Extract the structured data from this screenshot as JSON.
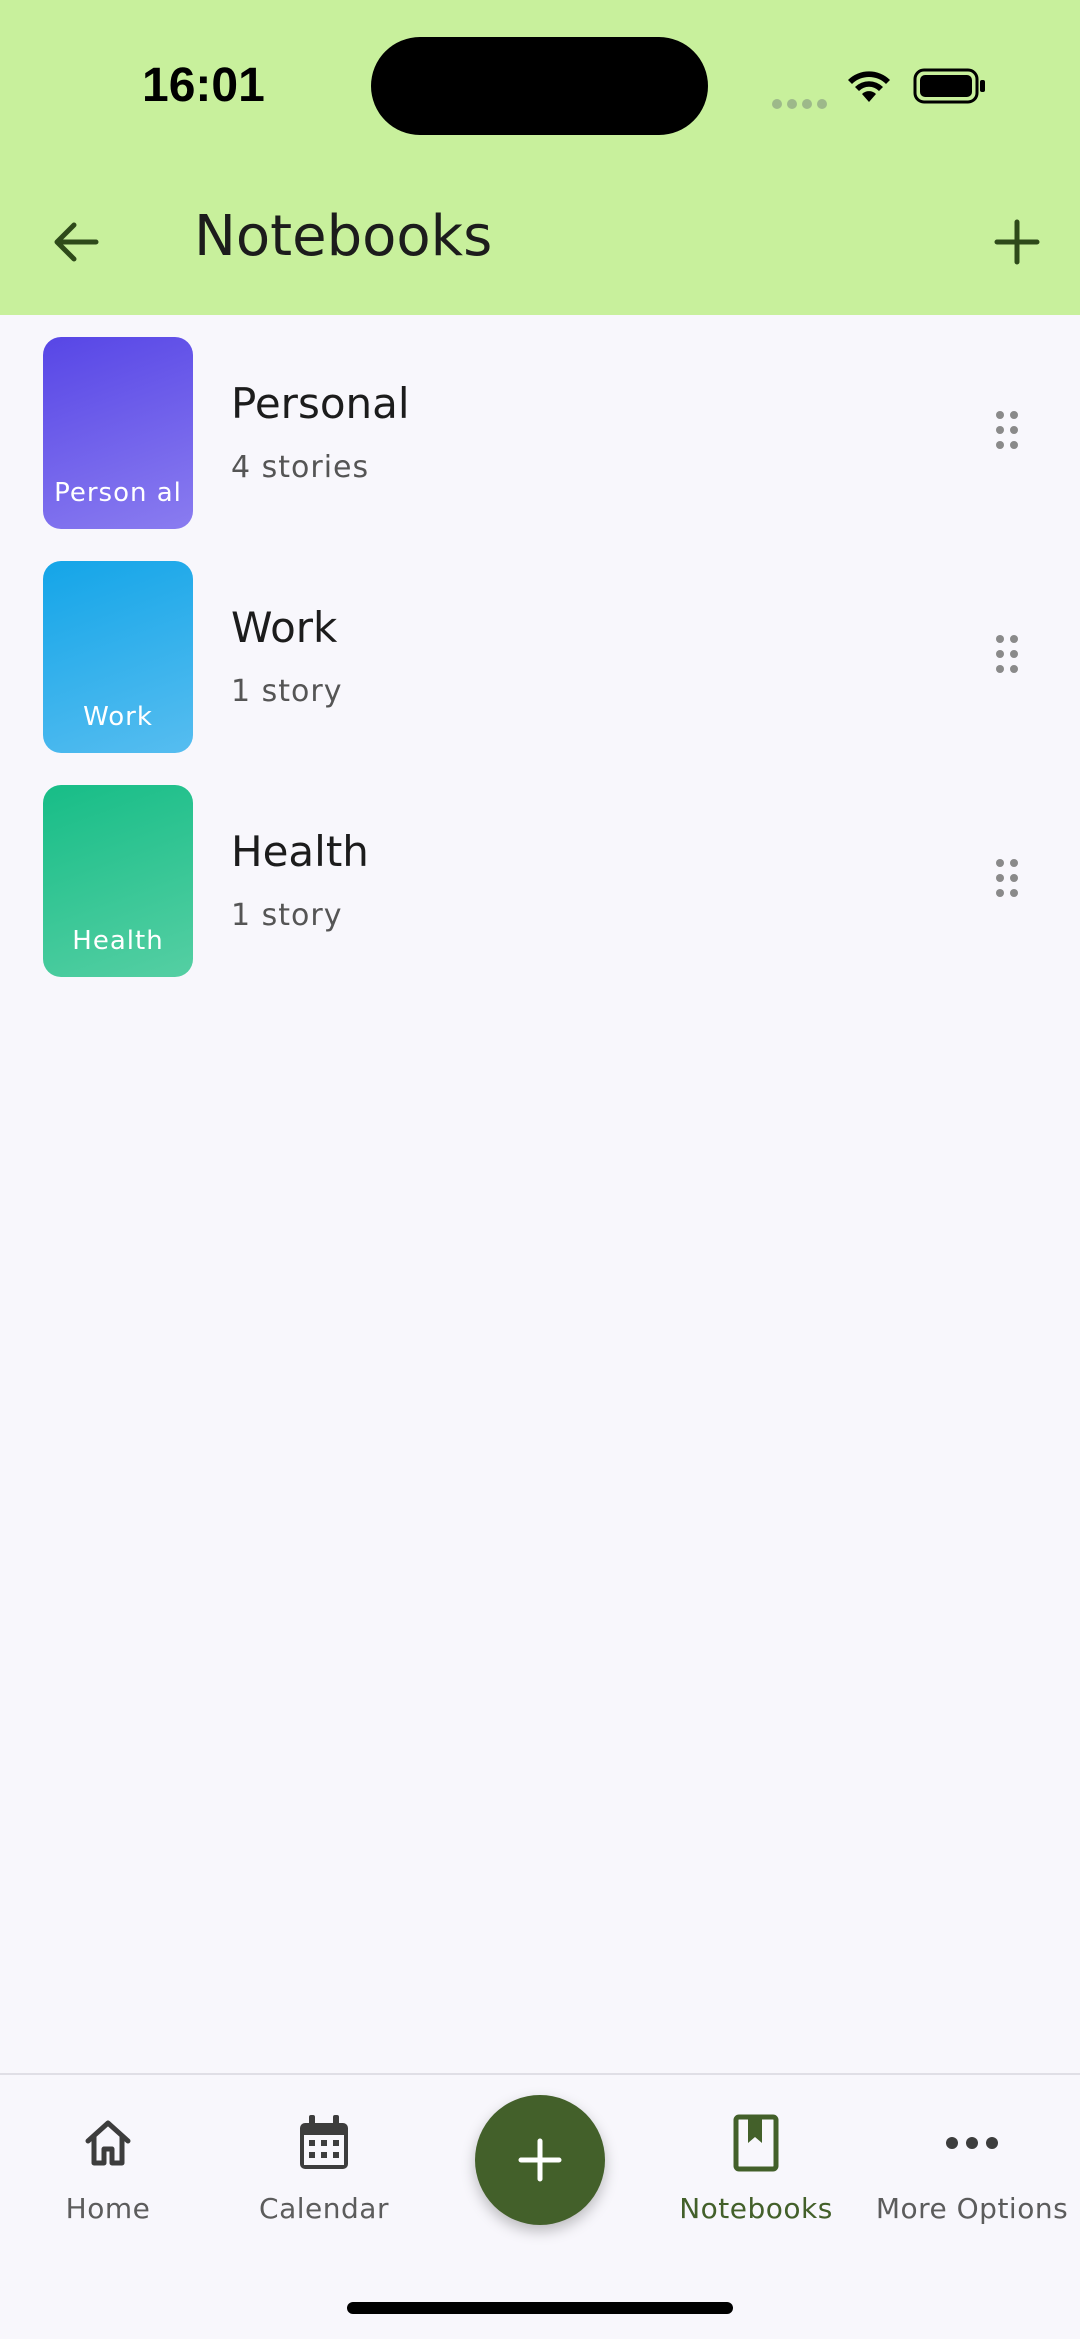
{
  "status_bar": {
    "time": "16:01"
  },
  "header": {
    "title": "Notebooks"
  },
  "notebooks": [
    {
      "name": "Personal",
      "count": "4 stories",
      "tile_label": "Person al",
      "gradient": [
        "#5746E6",
        "#8A7CF0"
      ]
    },
    {
      "name": "Work",
      "count": "1 story",
      "tile_label": "Work",
      "gradient": [
        "#14A5E8",
        "#56BDF0"
      ]
    },
    {
      "name": "Health",
      "count": "1 story",
      "tile_label": "Health",
      "gradient": [
        "#17BD87",
        "#55CFA3"
      ]
    }
  ],
  "bottom_nav": {
    "items": [
      {
        "label": "Home",
        "icon": "home-icon"
      },
      {
        "label": "Calendar",
        "icon": "calendar-icon"
      },
      {
        "label": "Notebooks",
        "icon": "notebook-icon",
        "active": true
      },
      {
        "label": "More Options",
        "icon": "more-icon"
      }
    ],
    "fab_icon": "plus-icon"
  },
  "colors": {
    "header_bg": "#C8F09C",
    "accent": "#43602A",
    "background": "#F8F7FC"
  }
}
